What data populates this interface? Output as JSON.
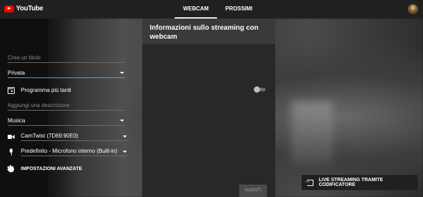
{
  "header": {
    "logo_text": "YouTube",
    "tabs": [
      {
        "label": "WEBCAM",
        "active": true
      },
      {
        "label": "PROSSIMI",
        "active": false
      }
    ]
  },
  "panel": {
    "title": "Informazioni sullo streaming con webcam",
    "title_placeholder": "Crea un titolo",
    "privacy_value": "Privata",
    "schedule_label": "Programma più tardi",
    "schedule_enabled": false,
    "description_placeholder": "Aggiungi una descrizione",
    "category_value": "Musica",
    "camera_value": "CamTwist (7D69:90E0)",
    "mic_value": "Predefinito - Microfono interno (Built-in)",
    "advanced_label": "IMPOSTAZIONI AVANZATE",
    "next_label": "AVANTI"
  },
  "encoder": {
    "label": "LIVE STREAMING TRAMITE CODIFICATORE"
  },
  "icons": {
    "schedule": "calendar-icon",
    "camera": "videocam-icon",
    "mic": "mic-icon",
    "advanced": "gear-icon",
    "encoder": "exit-to-app-icon"
  },
  "colors": {
    "topbar": "#202020",
    "panel": "#282828",
    "panel_header": "#3a3a3a",
    "focus_underline": "#3ea6ff",
    "brand_red": "#ff0000"
  }
}
